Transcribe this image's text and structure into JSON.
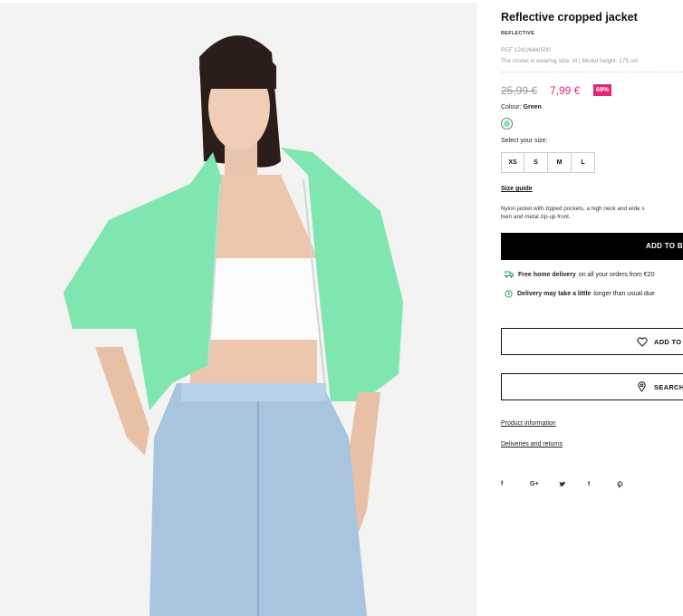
{
  "product": {
    "title": "Reflective cropped jacket",
    "brand_tag": "REFLECTIVE",
    "ref": "REF 1242/644/500",
    "model_info": "The model is wearing size: M | Model height: 175 cm",
    "old_price": "25,99 €",
    "new_price": "7,99 €",
    "discount": "69%",
    "colour_label": "Colour:",
    "colour_value": "Green",
    "colour_hex": "#7fe6b0",
    "select_size_label": "Select your size:",
    "sizes": [
      "XS",
      "S",
      "M",
      "L"
    ],
    "size_guide": "Size guide",
    "description_line1": "Nylon jacket with zipped pockets, a high neck and wide s",
    "description_line2": "hem and metal zip-up front.",
    "add_to_bag": "ADD TO B",
    "shipping_bold": "Free home delivery",
    "shipping_rest": "on all your orders from €20",
    "delay_bold": "Delivery may take a little",
    "delay_rest": "longer than usual due",
    "wishlist": "ADD TO",
    "search_store": "SEARCH",
    "product_information": "Product information",
    "deliveries_returns": "Deliveries and returns",
    "social": [
      "f",
      "G+",
      "t"
    ]
  },
  "icons": {
    "truck": "truck-icon",
    "clock": "clock-icon",
    "heart": "heart-icon",
    "pin": "location-pin-icon",
    "twitter": "twitter-icon",
    "pinterest": "pinterest-icon"
  }
}
